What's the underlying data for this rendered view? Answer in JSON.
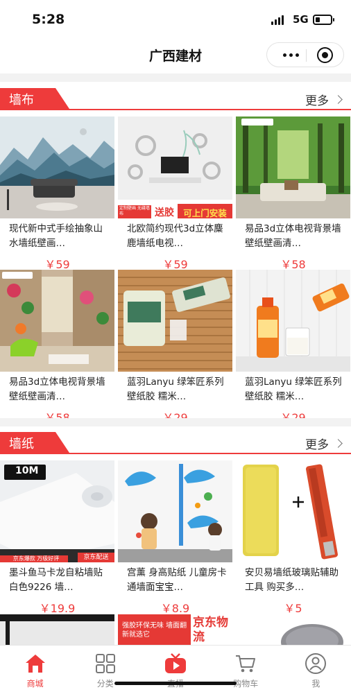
{
  "status": {
    "time": "5:28",
    "network": "5G"
  },
  "nav": {
    "title": "广西建材"
  },
  "sections": [
    {
      "title": "墙布",
      "more": "更多",
      "products": [
        {
          "name": "现代新中式手绘抽象山水墙纸壁画…",
          "price": "￥59"
        },
        {
          "name": "北欧简约现代3d立体麋鹿墙纸电视…",
          "price": "￥59",
          "badge_small": "定制壁画 无缝墙布",
          "badge_main": "送胶",
          "badge_extra": "可上门安装"
        },
        {
          "name": "易品3d立体电视背景墙壁纸壁画清…",
          "price": "￥58"
        },
        {
          "name": "易品3d立体电视背景墙壁纸壁画清…",
          "price": "￥58"
        },
        {
          "name": "蓝羽Lanyu 绿笨匠系列 壁纸胶 糯米…",
          "price": "￥29"
        },
        {
          "name": "蓝羽Lanyu 绿笨匠系列 壁纸胶 糯米…",
          "price": "￥29"
        }
      ]
    },
    {
      "title": "墙纸",
      "more": "更多",
      "products": [
        {
          "name": "墨斗鱼马卡龙自粘墙贴白色9226 墙…",
          "price": "￥19.9",
          "badge_small": "10M",
          "badge_bottom": "京东爆款 万级好评",
          "badge_corner": "京东配送"
        },
        {
          "name": "宫薰 身高贴纸 儿童房卡通墙面宝宝…",
          "price": "￥8.9"
        },
        {
          "name": "安贝易墙纸玻璃贴辅助工具 购买多…",
          "price": "￥5"
        }
      ]
    }
  ],
  "partial_row": {
    "banner_text": "京东物流",
    "banner_sub": "强胶环保无味 墙面翻新就选它"
  },
  "tabs": [
    {
      "label": "商城",
      "icon": "home-icon",
      "active": true
    },
    {
      "label": "分类",
      "icon": "grid-icon",
      "active": false
    },
    {
      "label": "直播",
      "icon": "live-tv-icon",
      "active": false
    },
    {
      "label": "购物车",
      "icon": "cart-icon",
      "active": false
    },
    {
      "label": "我",
      "icon": "user-icon",
      "active": false
    }
  ],
  "colors": {
    "accent": "#ee3b3b",
    "text": "#222222",
    "muted": "#888888"
  }
}
